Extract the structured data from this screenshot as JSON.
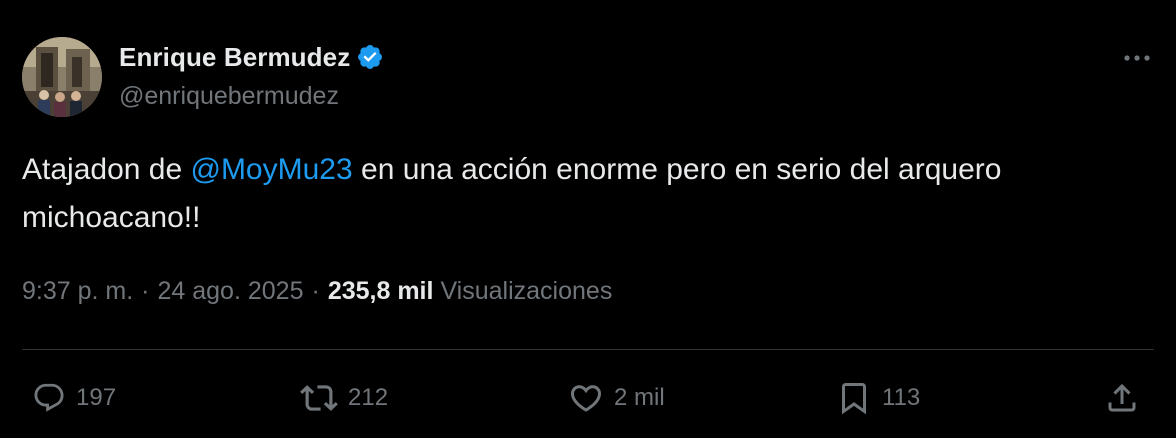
{
  "author": {
    "display_name": "Enrique Bermudez",
    "handle": "@enriquebermudez",
    "verified": true,
    "verified_color": "#1d9bf0"
  },
  "tweet": {
    "text_before": "Atajadon de ",
    "mention": "@MoyMu23",
    "text_after": " en una acción enorme pero en serio del arquero michoacano!!"
  },
  "meta": {
    "time": "9:37 p. m.",
    "separator": "·",
    "date": "24 ago. 2025",
    "views_count": "235,8 mil",
    "views_label": "Visualizaciones"
  },
  "actions": {
    "replies": {
      "icon": "reply-icon",
      "count": "197"
    },
    "reposts": {
      "icon": "repost-icon",
      "count": "212"
    },
    "likes": {
      "icon": "heart-icon",
      "count": "2 mil"
    },
    "bookmarks": {
      "icon": "bookmark-icon",
      "count": "113"
    },
    "share": {
      "icon": "share-icon"
    }
  },
  "colors": {
    "background": "#000000",
    "text": "#e7e9ea",
    "muted": "#71767b",
    "link": "#1d9bf0",
    "divider": "#2f3336"
  }
}
